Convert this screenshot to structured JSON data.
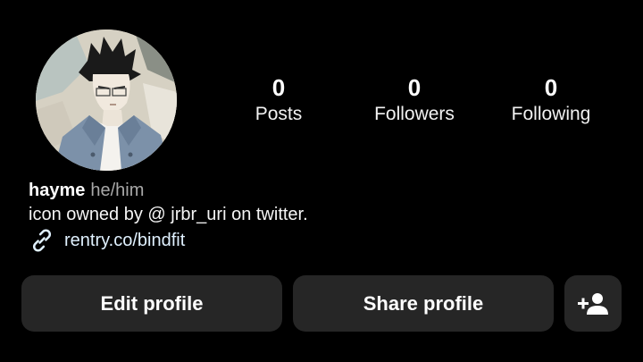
{
  "profile": {
    "username": "hayme",
    "pronouns": "he/him",
    "bio": "icon owned by @ jrbr_uri on twitter.",
    "link": "rentry.co/bindfit",
    "avatar_icon": "anime-character-avatar"
  },
  "stats": [
    {
      "value": "0",
      "label": "Posts"
    },
    {
      "value": "0",
      "label": "Followers"
    },
    {
      "value": "0",
      "label": "Following"
    }
  ],
  "actions": {
    "edit_label": "Edit profile",
    "share_label": "Share profile",
    "add_icon": "person-add-icon"
  },
  "colors": {
    "background": "#000000",
    "button": "#262626",
    "link": "#e0f1ff",
    "muted": "#a8a8a8"
  }
}
